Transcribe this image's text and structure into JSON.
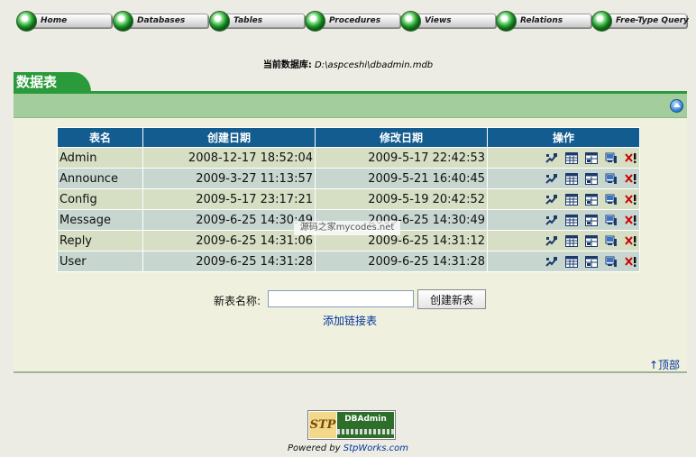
{
  "nav": {
    "items": [
      {
        "label": "Home",
        "icon": "green-orb-icon"
      },
      {
        "label": "Databases",
        "icon": "green-orb-icon"
      },
      {
        "label": "Tables",
        "icon": "green-orb-icon"
      },
      {
        "label": "Procedures",
        "icon": "green-orb-icon"
      },
      {
        "label": "Views",
        "icon": "green-orb-icon"
      },
      {
        "label": "Relations",
        "icon": "green-orb-icon"
      },
      {
        "label": "Free-Type Query",
        "icon": "green-orb-icon"
      }
    ]
  },
  "current_db": {
    "label": "当前数据库:",
    "value": "D:\\aspceshi\\dbadmin.mdb"
  },
  "panel": {
    "title": "数据表",
    "collapse_icon": "collapse-up-icon"
  },
  "table": {
    "headers": [
      "表名",
      "创建日期",
      "修改日期",
      "操作"
    ],
    "rows": [
      {
        "name": "Admin",
        "created": "2008-12-17 18:52:04",
        "modified": "2009-5-17 22:42:53"
      },
      {
        "name": "Announce",
        "created": "2009-3-27 11:13:57",
        "modified": "2009-5-21 16:40:45"
      },
      {
        "name": "Config",
        "created": "2009-5-17 23:17:21",
        "modified": "2009-5-19 20:42:52"
      },
      {
        "name": "Message",
        "created": "2009-6-25 14:30:49",
        "modified": "2009-6-25 14:30:49"
      },
      {
        "name": "Reply",
        "created": "2009-6-25 14:31:06",
        "modified": "2009-6-25 14:31:12"
      },
      {
        "name": "User",
        "created": "2009-6-25 14:31:28",
        "modified": "2009-6-25 14:31:28"
      }
    ],
    "operation_icons": [
      "structure-icon",
      "browse-data-icon",
      "edit-table-icon",
      "export-icon",
      "delete-icon"
    ]
  },
  "new_table": {
    "label": "新表名称:",
    "input_value": "",
    "input_placeholder": "",
    "button_label": "创建新表"
  },
  "links": {
    "add_link_table": "添加链接表",
    "top": "↑顶部"
  },
  "watermark": "源码之家mycodes.net",
  "footer": {
    "logo_left": "STP",
    "logo_right": "DBAdmin",
    "powered_prefix": "Powered by ",
    "powered_link": "StpWorks.com"
  },
  "colors": {
    "accent_green": "#2A9A3A",
    "header_blue": "#125C90",
    "link_blue": "#00339A",
    "delete_red": "#CC0000"
  }
}
